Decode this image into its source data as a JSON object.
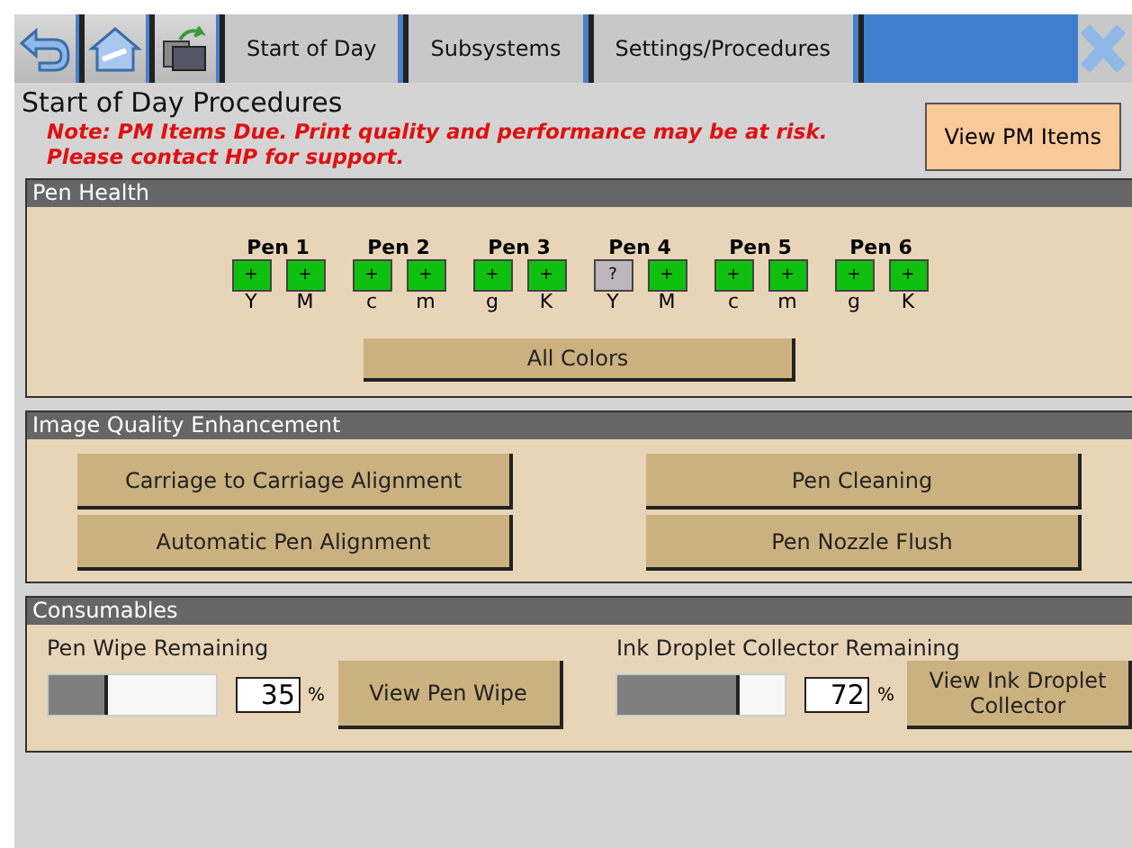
{
  "toolbar": {
    "tabs": [
      {
        "label": "Start of Day",
        "selected": false
      },
      {
        "label": "Subsystems",
        "selected": false
      },
      {
        "label": "Settings/Procedures",
        "selected": false
      }
    ]
  },
  "page": {
    "title": "Start of Day Procedures",
    "note": "Note: PM Items Due. Print quality and performance may be at risk.\nPlease contact HP for support.",
    "pm_button": "View PM Items"
  },
  "pen_health": {
    "title": "Pen Health",
    "pens": [
      {
        "name": "Pen 1",
        "slots": [
          {
            "kind": "ok",
            "symbol": "+",
            "letter": "Y"
          },
          {
            "kind": "ok",
            "symbol": "+",
            "letter": "M"
          }
        ]
      },
      {
        "name": "Pen 2",
        "slots": [
          {
            "kind": "ok",
            "symbol": "+",
            "letter": "c"
          },
          {
            "kind": "ok",
            "symbol": "+",
            "letter": "m"
          }
        ]
      },
      {
        "name": "Pen 3",
        "slots": [
          {
            "kind": "ok",
            "symbol": "+",
            "letter": "g"
          },
          {
            "kind": "ok",
            "symbol": "+",
            "letter": "K"
          }
        ]
      },
      {
        "name": "Pen 4",
        "slots": [
          {
            "kind": "unknown",
            "symbol": "?",
            "letter": "Y"
          },
          {
            "kind": "ok",
            "symbol": "+",
            "letter": "M"
          }
        ]
      },
      {
        "name": "Pen 5",
        "slots": [
          {
            "kind": "ok",
            "symbol": "+",
            "letter": "c"
          },
          {
            "kind": "ok",
            "symbol": "+",
            "letter": "m"
          }
        ]
      },
      {
        "name": "Pen 6",
        "slots": [
          {
            "kind": "ok",
            "symbol": "+",
            "letter": "g"
          },
          {
            "kind": "ok",
            "symbol": "+",
            "letter": "K"
          }
        ]
      }
    ],
    "button": "All Colors"
  },
  "image_quality": {
    "title": "Image Quality Enhancement",
    "buttons": [
      "Carriage to Carriage Alignment",
      "Pen Cleaning",
      "Automatic Pen Alignment",
      "Pen Nozzle Flush"
    ]
  },
  "consumables": {
    "title": "Consumables",
    "items": [
      {
        "label": "Pen Wipe Remaining",
        "level": 0.35,
        "value": "35",
        "unit": "%",
        "button": "View Pen Wipe"
      },
      {
        "label": "Ink Droplet Collector Remaining",
        "level": 0.73,
        "value": "72",
        "unit": "%",
        "button": "View Ink Droplet Collector"
      }
    ]
  }
}
